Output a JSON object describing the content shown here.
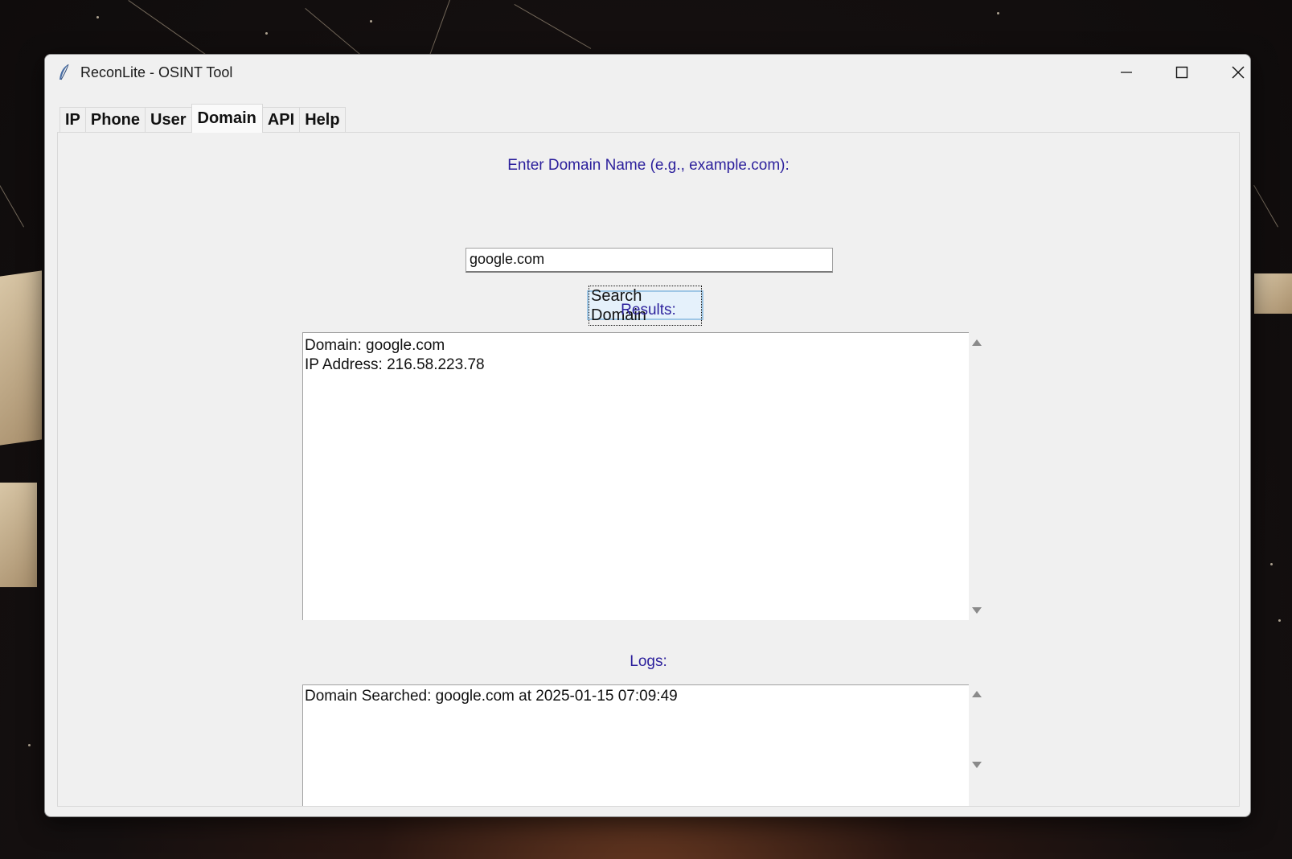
{
  "window": {
    "title": "ReconLite - OSINT Tool",
    "app_icon": "feather-icon",
    "controls": [
      "minimize-icon",
      "maximize-icon",
      "close-icon"
    ]
  },
  "tabs": [
    {
      "label": "IP",
      "active": false
    },
    {
      "label": "Phone",
      "active": false
    },
    {
      "label": "User",
      "active": false
    },
    {
      "label": "Domain",
      "active": true
    },
    {
      "label": "API",
      "active": false
    },
    {
      "label": "Help",
      "active": false
    }
  ],
  "domain_tab": {
    "prompt_label": "Enter Domain Name (e.g., example.com):",
    "domain_input_value": "google.com",
    "search_button_label": "Search Domain",
    "results_label": "Results:",
    "results_lines": [
      "Domain: google.com",
      "IP Address: 216.58.223.78"
    ],
    "logs_label": "Logs:",
    "logs_lines": [
      "Domain Searched: google.com at 2025-01-15 07:09:49"
    ]
  },
  "colors": {
    "label_blue": "#2b1f9c",
    "window_bg": "#f0f0f0",
    "button_focus_bg": "#e5f1fb",
    "button_focus_border": "#9fc7e6"
  }
}
